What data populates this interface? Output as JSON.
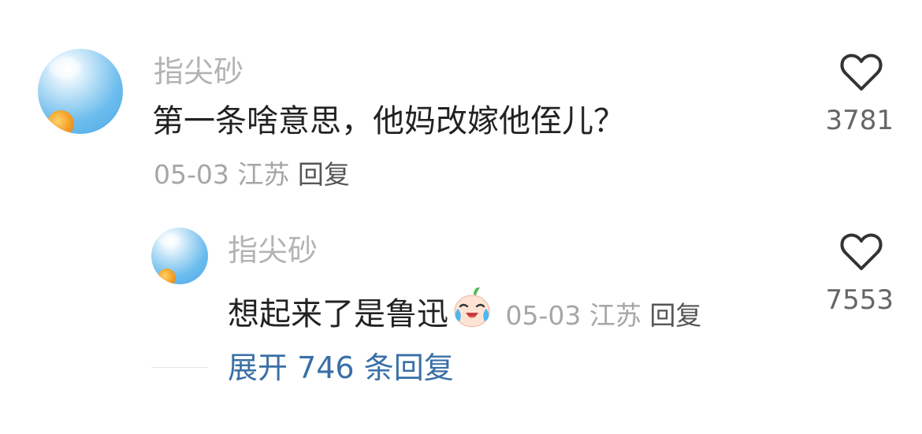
{
  "comment": {
    "username": "指尖砂",
    "text": "第一条啥意思，他妈改嫁他侄儿？",
    "date": "05-03",
    "location": "江苏",
    "reply_label": "回复",
    "like_count": "3781",
    "like_icon": "heart-outline-icon"
  },
  "reply": {
    "username": "指尖砂",
    "text": "想起来了是鲁迅",
    "emoji": "crying-laughing-emoji",
    "date": "05-03",
    "location": "江苏",
    "reply_label": "回复",
    "like_count": "7553",
    "like_icon": "heart-outline-icon"
  },
  "expand": {
    "label": "展开 746 条回复"
  },
  "colors": {
    "username": "#b3b3b3",
    "text": "#222222",
    "meta": "#a6a6a6",
    "link": "#3a6fa6"
  }
}
